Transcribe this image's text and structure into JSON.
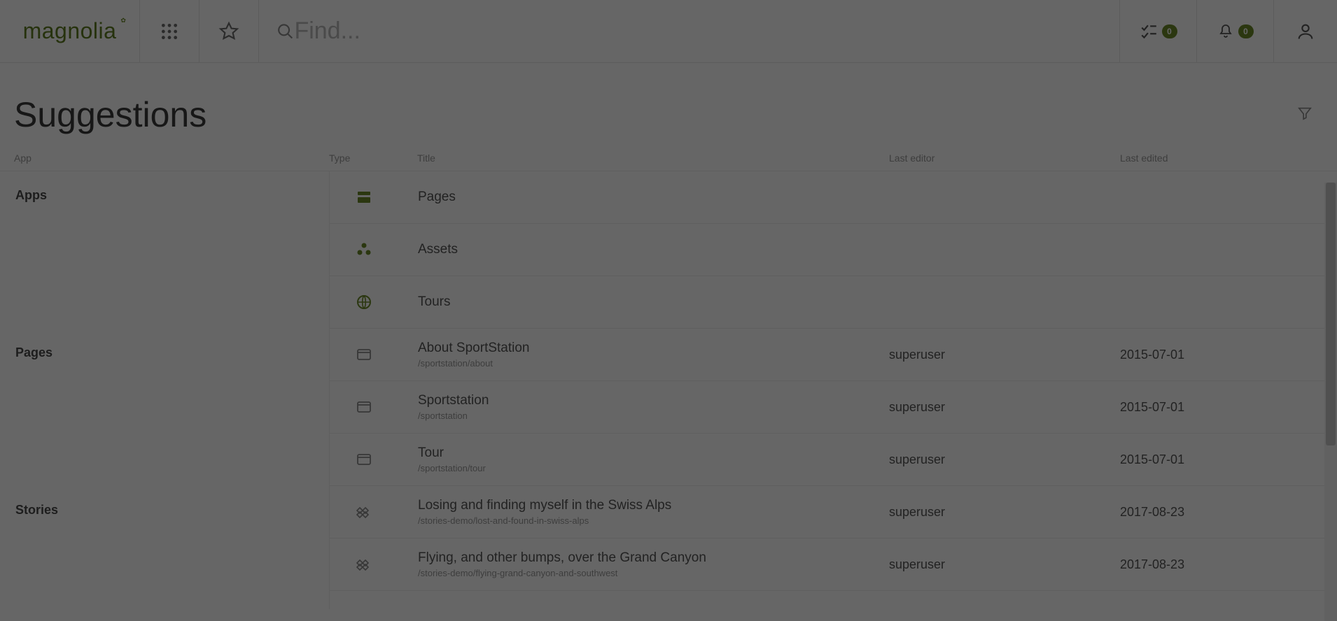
{
  "brand": "magnolia",
  "header": {
    "search_placeholder": "Find...",
    "tasks_count": "0",
    "notifications_count": "0"
  },
  "suggestions": {
    "heading": "Suggestions",
    "columns": {
      "app": "App",
      "type": "Type",
      "title": "Title",
      "last_editor": "Last editor",
      "last_edited": "Last edited"
    },
    "groups": [
      {
        "label": "Apps",
        "span": 3,
        "rows": [
          {
            "icon": "app-pages-icon",
            "title": "Pages",
            "path": "",
            "editor": "",
            "edited": ""
          },
          {
            "icon": "app-assets-icon",
            "title": "Assets",
            "path": "",
            "editor": "",
            "edited": ""
          },
          {
            "icon": "app-tours-icon",
            "title": "Tours",
            "path": "",
            "editor": "",
            "edited": ""
          }
        ]
      },
      {
        "label": "Pages",
        "span": 3,
        "rows": [
          {
            "icon": "page-icon",
            "title": "About SportStation",
            "path": "/sportstation/about",
            "editor": "superuser",
            "edited": "2015-07-01"
          },
          {
            "icon": "page-icon",
            "title": "Sportstation",
            "path": "/sportstation",
            "editor": "superuser",
            "edited": "2015-07-01"
          },
          {
            "icon": "page-icon",
            "title": "Tour",
            "path": "/sportstation/tour",
            "editor": "superuser",
            "edited": "2015-07-01"
          }
        ]
      },
      {
        "label": "Stories",
        "span": 2,
        "rows": [
          {
            "icon": "story-icon",
            "title": "Losing and finding myself in the Swiss Alps",
            "path": "/stories-demo/lost-and-found-in-swiss-alps",
            "editor": "superuser",
            "edited": "2017-08-23"
          },
          {
            "icon": "story-icon",
            "title": "Flying, and other bumps, over the Grand Canyon",
            "path": "/stories-demo/flying-grand-canyon-and-southwest",
            "editor": "superuser",
            "edited": "2017-08-23"
          }
        ]
      }
    ]
  },
  "colors": {
    "accent": "#6c8a2a"
  }
}
